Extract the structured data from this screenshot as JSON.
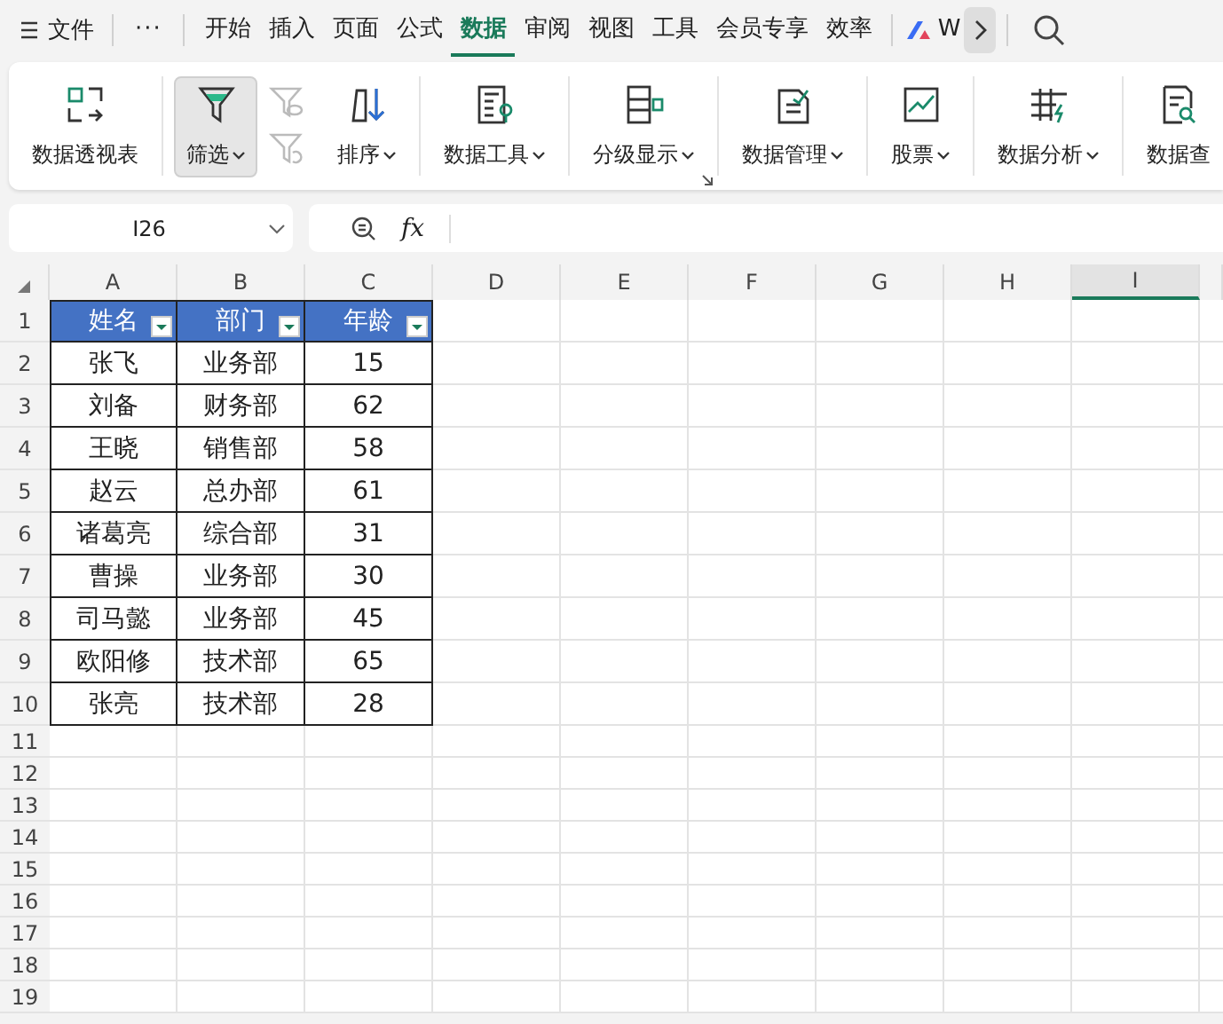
{
  "menu": {
    "file": "文件",
    "more": "···",
    "tabs": [
      {
        "label": "开始",
        "selected": false
      },
      {
        "label": "插入",
        "selected": false
      },
      {
        "label": "页面",
        "selected": false
      },
      {
        "label": "公式",
        "selected": false
      },
      {
        "label": "数据",
        "selected": true
      },
      {
        "label": "审阅",
        "selected": false
      },
      {
        "label": "视图",
        "selected": false
      },
      {
        "label": "工具",
        "selected": false
      },
      {
        "label": "会员专享",
        "selected": false
      },
      {
        "label": "效率",
        "selected": false
      }
    ],
    "app_label": "W"
  },
  "ribbon": [
    {
      "kind": "large",
      "label": "数据透视表",
      "dropdown": false,
      "pressed": false
    },
    {
      "kind": "large",
      "label": "筛选",
      "dropdown": true,
      "pressed": true
    },
    {
      "kind": "pair",
      "disabled": true
    },
    {
      "kind": "large",
      "label": "排序",
      "dropdown": true,
      "pressed": false
    },
    {
      "kind": "large",
      "label": "数据工具",
      "dropdown": true,
      "pressed": false
    },
    {
      "kind": "large",
      "label": "分级显示",
      "dropdown": true,
      "pressed": false,
      "launcher": true
    },
    {
      "kind": "large",
      "label": "数据管理",
      "dropdown": true,
      "pressed": false
    },
    {
      "kind": "large",
      "label": "股票",
      "dropdown": true,
      "pressed": false
    },
    {
      "kind": "large",
      "label": "数据分析",
      "dropdown": true,
      "pressed": false
    },
    {
      "kind": "large",
      "label": "数据查",
      "dropdown": false,
      "pressed": false
    }
  ],
  "name_box": "I26",
  "formula_bar": {
    "fx": "fx"
  },
  "columns": [
    {
      "label": "A",
      "selected": false
    },
    {
      "label": "B",
      "selected": false
    },
    {
      "label": "C",
      "selected": false
    },
    {
      "label": "D",
      "selected": false
    },
    {
      "label": "E",
      "selected": false
    },
    {
      "label": "F",
      "selected": false
    },
    {
      "label": "G",
      "selected": false
    },
    {
      "label": "H",
      "selected": false
    },
    {
      "label": "I",
      "selected": true
    }
  ],
  "row_headers": [
    "1",
    "2",
    "3",
    "4",
    "5",
    "6",
    "7",
    "8",
    "9",
    "10",
    "11",
    "12",
    "13",
    "14",
    "15",
    "16",
    "17",
    "18",
    "19"
  ],
  "table": {
    "headers": [
      "姓名",
      "部门",
      "年龄"
    ],
    "rows": [
      [
        "张飞",
        "业务部",
        "15"
      ],
      [
        "刘备",
        "财务部",
        "62"
      ],
      [
        "王晓",
        "销售部",
        "58"
      ],
      [
        "赵云",
        "总办部",
        "61"
      ],
      [
        "诸葛亮",
        "综合部",
        "31"
      ],
      [
        "曹操",
        "业务部",
        "30"
      ],
      [
        "司马懿",
        "业务部",
        "45"
      ],
      [
        "欧阳修",
        "技术部",
        "65"
      ],
      [
        "张亮",
        "技术部",
        "28"
      ]
    ]
  }
}
